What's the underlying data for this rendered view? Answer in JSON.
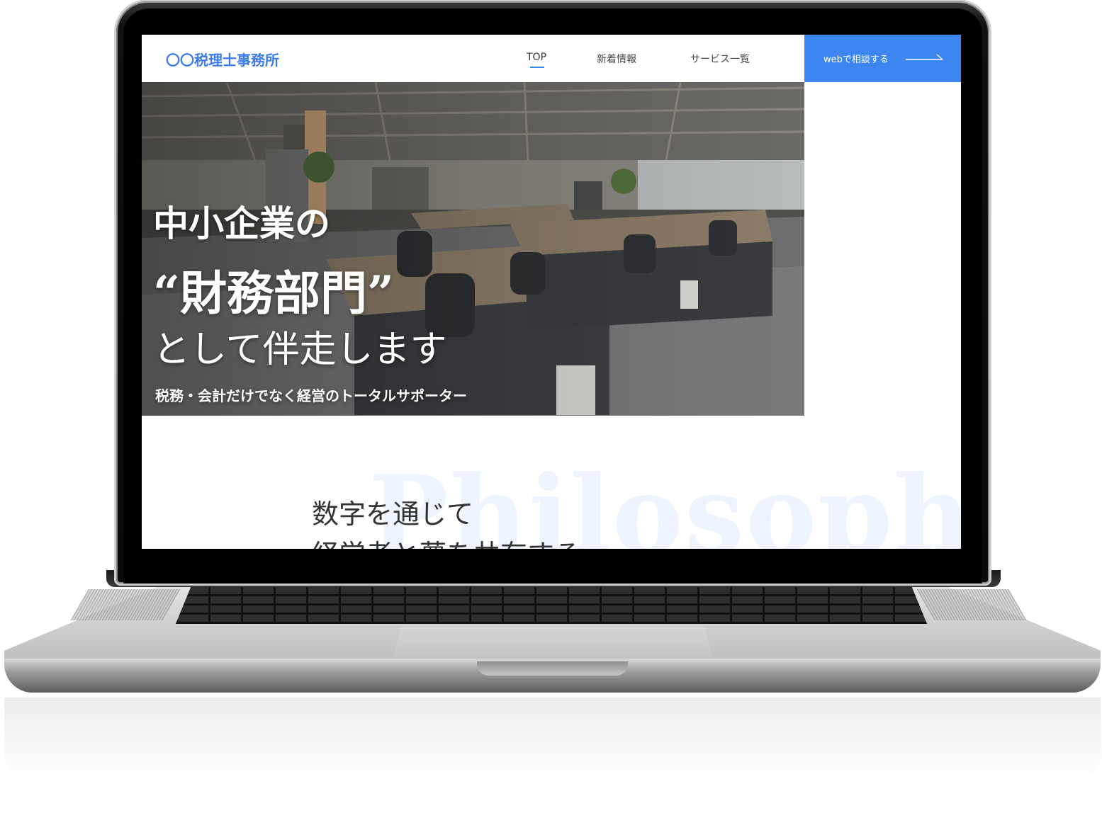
{
  "header": {
    "logo": "〇〇税理士事務所",
    "nav": [
      {
        "label": "TOP",
        "active": true
      },
      {
        "label": "新着情報",
        "active": false
      },
      {
        "label": "サービス一覧",
        "active": false
      }
    ],
    "cta_label": "webで相談する",
    "accent_color": "#3d86f2"
  },
  "hero": {
    "line1": "中小企業の",
    "line2": "“財務部門”",
    "line3": "として伴走します",
    "tagline": "税務・会計だけでなく経営のトータルサポーター"
  },
  "philosophy": {
    "bg_word": "Philosophy",
    "line1": "数字を通じて",
    "line2": "経営者と夢を共有する"
  },
  "icons": {
    "cta_arrow": "long-arrow-right-icon"
  }
}
